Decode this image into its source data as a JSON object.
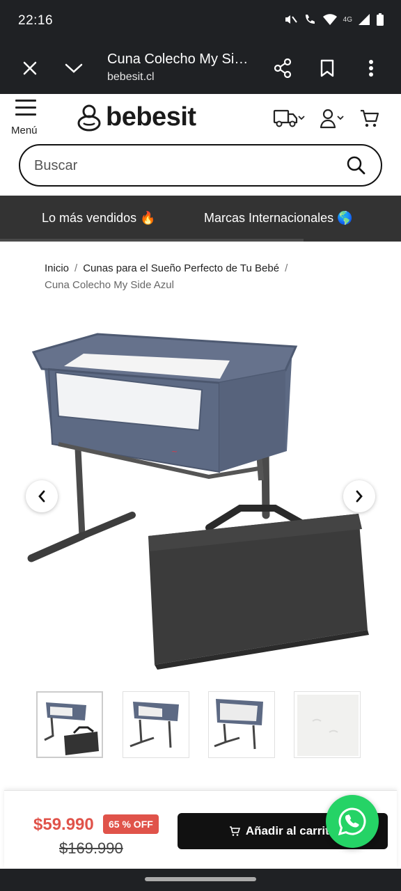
{
  "status_bar": {
    "time": "22:16",
    "network": "4G"
  },
  "browser": {
    "title": "Cuna Colecho My Side Azul",
    "url": "bebesit.cl"
  },
  "header": {
    "menu_label": "Menú",
    "logo_text": "bebesit"
  },
  "search": {
    "placeholder": "Buscar"
  },
  "promo": {
    "items": [
      {
        "label": "Lo más vendidos 🔥"
      },
      {
        "label": "Marcas Internacionales 🌎"
      }
    ]
  },
  "breadcrumb": {
    "home": "Inicio",
    "category": "Cunas para el Sueño Perfecto de Tu Bebé",
    "current": "Cuna Colecho My Side Azul"
  },
  "gallery": {
    "thumb_count": 4,
    "active_index": 0
  },
  "pricing": {
    "price": "$59.990",
    "discount": "65 % OFF",
    "old_price": "$169.990"
  },
  "cart": {
    "add_label": "Añadir al carrito"
  },
  "colors": {
    "accent": "#e0534a",
    "dark_bar": "#333333",
    "chrome": "#1f2124",
    "whatsapp": "#25d366"
  }
}
